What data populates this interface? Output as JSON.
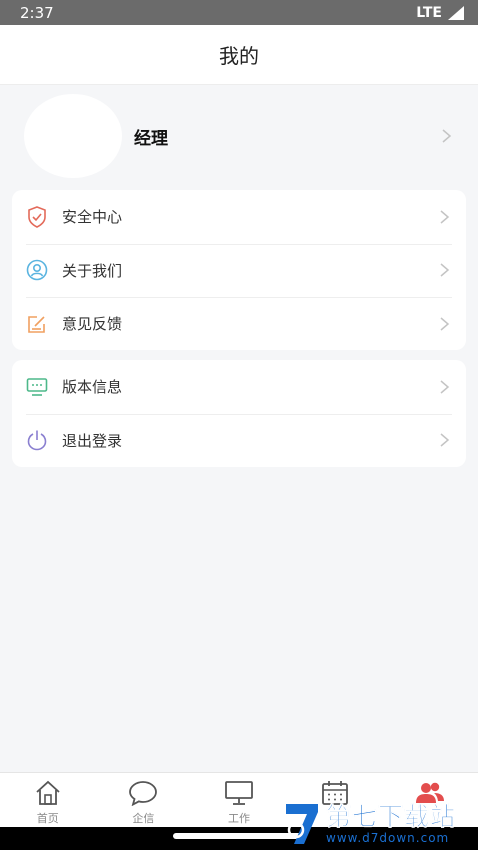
{
  "status_bar": {
    "time": "2:37",
    "network": "LTE"
  },
  "header": {
    "title": "我的"
  },
  "profile": {
    "name": "经理"
  },
  "menu_group_1": [
    {
      "label": "安全中心",
      "icon": "shield-icon"
    },
    {
      "label": "关于我们",
      "icon": "user-circle-icon"
    },
    {
      "label": "意见反馈",
      "icon": "feedback-edit-icon"
    }
  ],
  "menu_group_2": [
    {
      "label": "版本信息",
      "icon": "monitor-info-icon"
    },
    {
      "label": "退出登录",
      "icon": "power-icon"
    }
  ],
  "tabs": [
    {
      "label": "首页",
      "icon": "home-icon"
    },
    {
      "label": "企信",
      "icon": "chat-bubble-icon"
    },
    {
      "label": "工作",
      "icon": "desktop-icon"
    },
    {
      "label": "",
      "icon": "calendar-icon"
    },
    {
      "label": "",
      "icon": "people-icon",
      "active": true
    }
  ],
  "watermark": {
    "title": "第七下载站",
    "url": "www.d7down.com"
  },
  "colors": {
    "accent": "#e34d4d",
    "background": "#f5f6f8",
    "watermark": "#1a6fd1"
  }
}
